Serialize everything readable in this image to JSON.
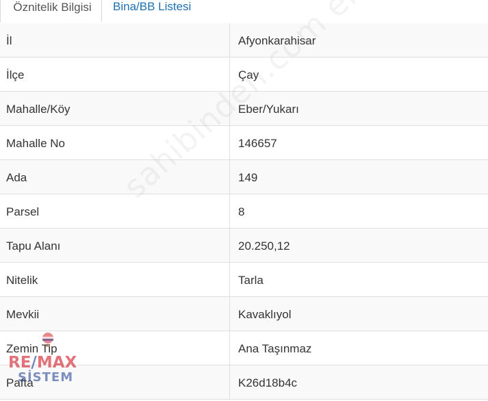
{
  "tabs": [
    {
      "label": "Öznitelik Bilgisi",
      "active": true
    },
    {
      "label": "Bina/BB Listesi",
      "active": false
    }
  ],
  "rows": [
    {
      "label": "İl",
      "value": "Afyonkarahisar"
    },
    {
      "label": "İlçe",
      "value": "Çay"
    },
    {
      "label": "Mahalle/Köy",
      "value": "Eber/Yukarı"
    },
    {
      "label": "Mahalle No",
      "value": "146657"
    },
    {
      "label": "Ada",
      "value": "149"
    },
    {
      "label": "Parsel",
      "value": "8"
    },
    {
      "label": "Tapu Alanı",
      "value": "20.250,12"
    },
    {
      "label": "Nitelik",
      "value": "Tarla"
    },
    {
      "label": "Mevkii",
      "value": "Kavaklıyol"
    },
    {
      "label": "Zemin Tip",
      "value": "Ana Taşınmaz"
    },
    {
      "label": "Pafta",
      "value": "K26d18b4c"
    }
  ],
  "watermark": "sahibinden.com emlakjet.com",
  "logo": {
    "brand_re": "RE",
    "brand_slash": "/",
    "brand_max": "MAX",
    "sub": "SİSTEM"
  },
  "colors": {
    "link_tab": "#1e6fb0",
    "row_border": "#dedede",
    "logo_red": "#d22832",
    "logo_blue": "#284696"
  }
}
